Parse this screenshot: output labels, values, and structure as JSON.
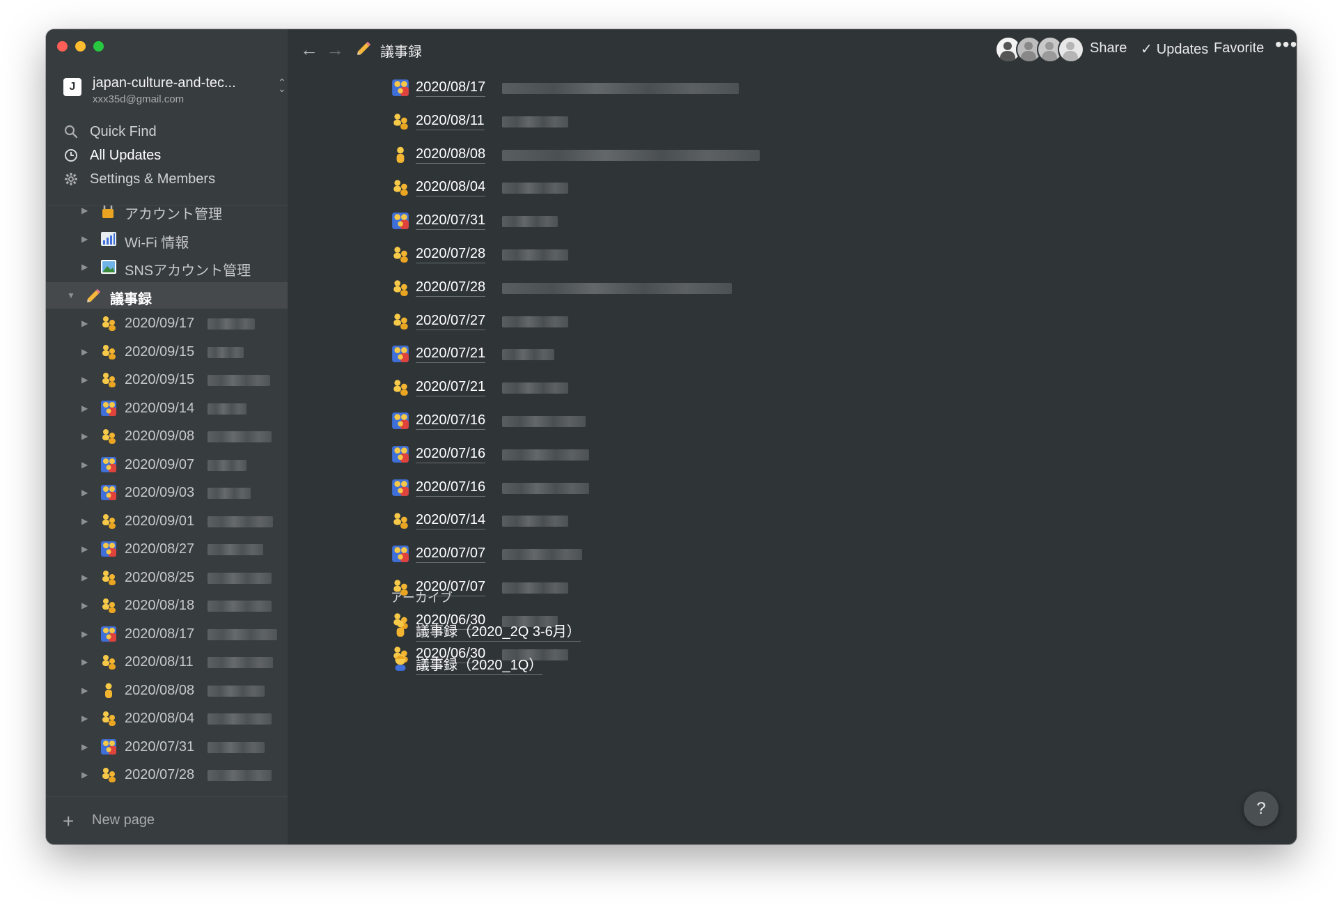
{
  "window": {
    "traffic_lights": [
      "close",
      "minimize",
      "zoom"
    ]
  },
  "workspace": {
    "initial": "J",
    "name": "japan-culture-and-tec...",
    "email": "xxx35d@gmail.com"
  },
  "menu": {
    "quick_find": "Quick Find",
    "all_updates": "All Updates",
    "settings": "Settings & Members"
  },
  "tree": {
    "pages": [
      {
        "label": "アカウント管理",
        "icon": "lock-with-key-icon"
      },
      {
        "label": "Wi-Fi 情報",
        "icon": "bar-chart-icon"
      },
      {
        "label": "SNSアカウント管理",
        "icon": "photo-icon"
      }
    ],
    "selected": {
      "label": "議事録",
      "icon": "pencil-icon"
    },
    "children": [
      {
        "label": "2020/09/17",
        "icon": "people-icon"
      },
      {
        "label": "2020/09/15",
        "icon": "people-icon"
      },
      {
        "label": "2020/09/15",
        "icon": "people-icon"
      },
      {
        "label": "2020/09/14",
        "icon": "family-icon"
      },
      {
        "label": "2020/09/08",
        "icon": "people-icon"
      },
      {
        "label": "2020/09/07",
        "icon": "family-icon"
      },
      {
        "label": "2020/09/03",
        "icon": "family-icon"
      },
      {
        "label": "2020/09/01",
        "icon": "people-icon"
      },
      {
        "label": "2020/08/27",
        "icon": "family-icon"
      },
      {
        "label": "2020/08/25",
        "icon": "people-icon"
      },
      {
        "label": "2020/08/18",
        "icon": "people-icon"
      },
      {
        "label": "2020/08/17",
        "icon": "family-icon"
      },
      {
        "label": "2020/08/11",
        "icon": "people-icon"
      },
      {
        "label": "2020/08/08",
        "icon": "person-icon"
      },
      {
        "label": "2020/08/04",
        "icon": "people-icon"
      },
      {
        "label": "2020/07/31",
        "icon": "family-icon"
      },
      {
        "label": "2020/07/28",
        "icon": "people-icon"
      }
    ]
  },
  "new_page": "New page",
  "topbar": {
    "breadcrumb": "議事録",
    "share": "Share",
    "updates": "Updates",
    "favorite": "Favorite",
    "more": "•••"
  },
  "content": {
    "entries": [
      {
        "label": "2020/08/17",
        "icon": "family-icon"
      },
      {
        "label": "2020/08/11",
        "icon": "people-icon"
      },
      {
        "label": "2020/08/08",
        "icon": "person-icon"
      },
      {
        "label": "2020/08/04",
        "icon": "people-icon"
      },
      {
        "label": "2020/07/31",
        "icon": "family-icon"
      },
      {
        "label": "2020/07/28",
        "icon": "people-icon"
      },
      {
        "label": "2020/07/28",
        "icon": "people-icon"
      },
      {
        "label": "2020/07/27",
        "icon": "people-icon"
      },
      {
        "label": "2020/07/21",
        "icon": "family-icon"
      },
      {
        "label": "2020/07/21",
        "icon": "people-icon"
      },
      {
        "label": "2020/07/16",
        "icon": "family-icon"
      },
      {
        "label": "2020/07/16",
        "icon": "family-icon"
      },
      {
        "label": "2020/07/16",
        "icon": "family-icon"
      },
      {
        "label": "2020/07/14",
        "icon": "people-icon"
      },
      {
        "label": "2020/07/07",
        "icon": "family-icon"
      },
      {
        "label": "2020/07/07",
        "icon": "people-icon"
      },
      {
        "label": "2020/06/30",
        "icon": "people-icon"
      },
      {
        "label": "2020/06/30",
        "icon": "people-icon"
      }
    ],
    "archive_heading": "アーカイブ",
    "archive": [
      {
        "label": "議事録（2020_2Q 3-6月）",
        "icon": "person-icon"
      },
      {
        "label": "議事録（2020_1Q）",
        "icon": "man-icon"
      }
    ]
  },
  "help": "?",
  "colors": {
    "sidebar_bg": "#373c3f",
    "content_bg": "#2f3437",
    "selected_bg": "#45494c",
    "text": "#ffffff"
  }
}
